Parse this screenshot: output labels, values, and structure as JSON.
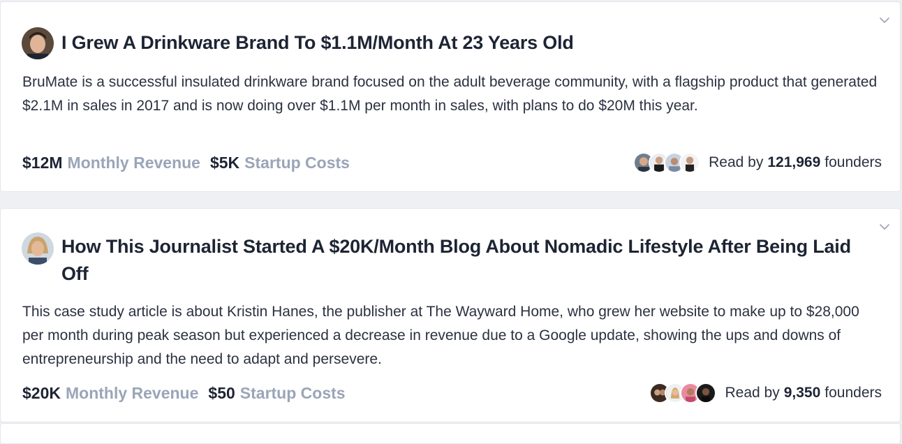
{
  "posts": [
    {
      "title": "I Grew A Drinkware Brand To $1.1M/Month At 23 Years Old",
      "description": "BruMate is a successful insulated drinkware brand focused on the adult beverage community, with a flagship product that generated $2.1M in sales in 2017 and is now doing over $1.1M per month in sales, with plans to do $20M this year.",
      "monthly_revenue_value": "$12M",
      "monthly_revenue_label": "Monthly Revenue",
      "startup_costs_value": "$5K",
      "startup_costs_label": "Startup Costs",
      "read_prefix": "Read by",
      "read_count": "121,969",
      "read_suffix": "founders"
    },
    {
      "title": "How This Journalist Started A $20K/Month Blog About Nomadic Lifestyle After Being Laid Off",
      "description": "This case study article is about Kristin Hanes, the publisher at The Wayward Home, who grew her website to make up to $28,000 per month during peak season but experienced a decrease in revenue due to a Google update, showing the ups and downs of entrepreneurship and the need to adapt and persevere.",
      "monthly_revenue_value": "$20K",
      "monthly_revenue_label": "Monthly Revenue",
      "startup_costs_value": "$50",
      "startup_costs_label": "Startup Costs",
      "read_prefix": "Read by",
      "read_count": "9,350",
      "read_suffix": "founders"
    }
  ],
  "icons": {
    "collapse": "chevron-down-icon",
    "author_avatar": "avatar",
    "reader_avatars": "reader-avatar"
  },
  "colors": {
    "title": "#1d2433",
    "muted_label": "#9aa5b8",
    "card_bg": "#ffffff",
    "page_bg": "#eef0f3"
  }
}
